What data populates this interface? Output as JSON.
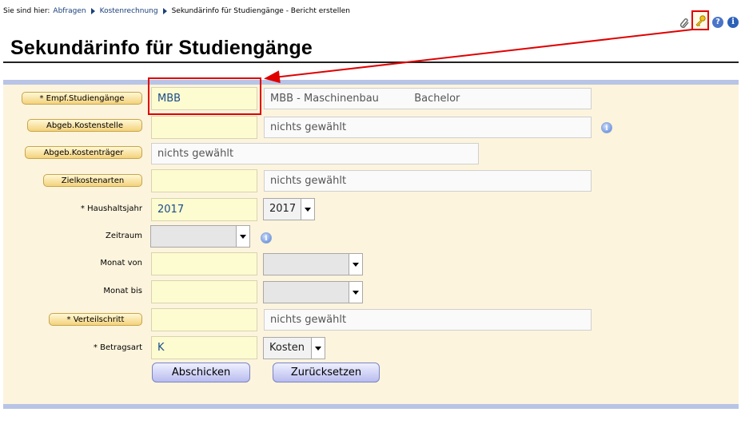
{
  "breadcrumb": {
    "prefix": "Sie sind hier:",
    "link1": "Abfragen",
    "link2": "Kostenrechnung",
    "current": "Sekundärinfo für Studiengänge - Bericht erstellen"
  },
  "page_title": "Sekundärinfo für Studiengänge",
  "icons": [
    "paperclip-icon",
    "key-icon",
    "help-icon",
    "info-icon"
  ],
  "form": {
    "empf_studiengaenge": {
      "label": "* Empf.Studiengänge",
      "code": "MBB",
      "desc_name": "MBB - Maschinenbau",
      "desc_degree": "Bachelor"
    },
    "abgeb_kostenstelle": {
      "label": "Abgeb.Kostenstelle",
      "code": "",
      "desc": "nichts gewählt"
    },
    "abgeb_kostentraeger": {
      "label": "Abgeb.Kostenträger",
      "desc": "nichts gewählt"
    },
    "zielkostenarten": {
      "label": "Zielkostenarten",
      "code": "",
      "desc": "nichts gewählt"
    },
    "haushaltsjahr": {
      "label": "* Haushaltsjahr",
      "value": "2017",
      "select": "2017"
    },
    "zeitraum": {
      "label": "Zeitraum",
      "select": ""
    },
    "monat_von": {
      "label": "Monat von",
      "value": "",
      "select": ""
    },
    "monat_bis": {
      "label": "Monat bis",
      "value": "",
      "select": ""
    },
    "verteilschritt": {
      "label": "* Verteilschritt",
      "code": "",
      "desc": "nichts gewählt"
    },
    "betragsart": {
      "label": "* Betragsart",
      "value": "K",
      "select": "Kosten"
    }
  },
  "buttons": {
    "submit": "Abschicken",
    "reset": "Zurücksetzen"
  },
  "colors": {
    "highlight": "#e00000",
    "panel_bg": "#fcf4dd",
    "field_yellow": "#fdfbd0"
  }
}
